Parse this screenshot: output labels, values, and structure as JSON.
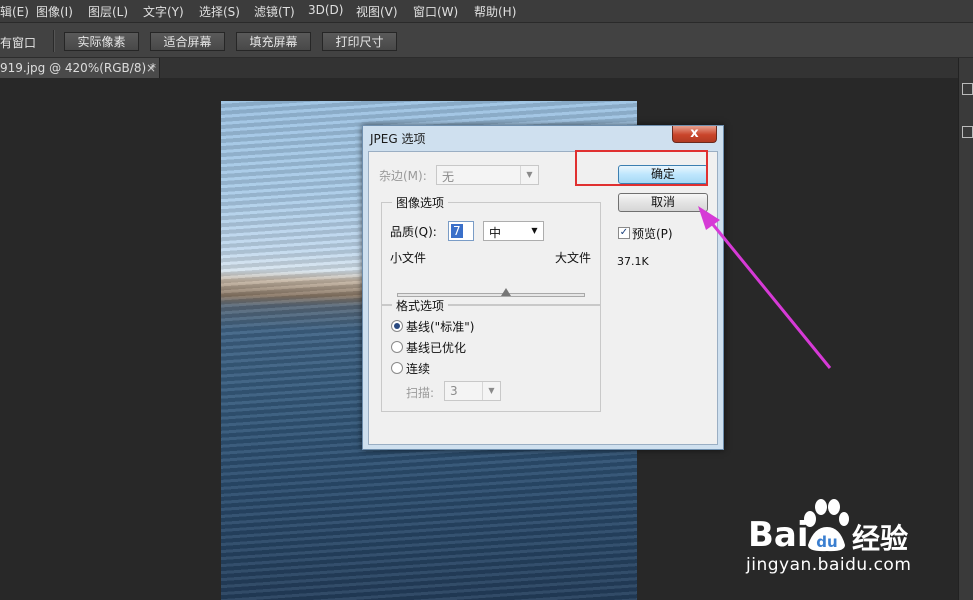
{
  "menu": {
    "items": [
      "辑(E)",
      "图像(I)",
      "图层(L)",
      "文字(Y)",
      "选择(S)",
      "滤镜(T)",
      "3D(D)",
      "视图(V)",
      "窗口(W)",
      "帮助(H)"
    ]
  },
  "options_bar": {
    "partial_label": "有窗口",
    "buttons": [
      "实际像素",
      "适合屏幕",
      "填充屏幕",
      "打印尺寸"
    ]
  },
  "document_tab": {
    "title": "919.jpg @ 420%(RGB/8) *",
    "close": "×"
  },
  "dialog": {
    "title": "JPEG 选项",
    "close_symbol": "x",
    "matte_label": "杂边(M):",
    "matte_value": "无",
    "image_options_title": "图像选项",
    "quality_label": "品质(Q):",
    "quality_value": "7",
    "quality_preset": "中",
    "small_file": "小文件",
    "large_file": "大文件",
    "quality_slider_fraction": 0.58,
    "format_options_title": "格式选项",
    "format_baseline_standard": "基线(\"标准\")",
    "format_baseline_optimized": "基线已优化",
    "format_progressive": "连续",
    "scans_label": "扫描:",
    "scans_value": "3",
    "ok_label": "确定",
    "cancel_label": "取消",
    "preview_label": "预览(P)",
    "preview_checked": true,
    "file_size": "37.1K"
  },
  "watermark": {
    "brand": "Bai",
    "brand_cn": "经验",
    "url": "jingyan.baidu.com"
  },
  "colors": {
    "annotation_red": "#e03030",
    "annotation_arrow": "#d63ad6"
  }
}
